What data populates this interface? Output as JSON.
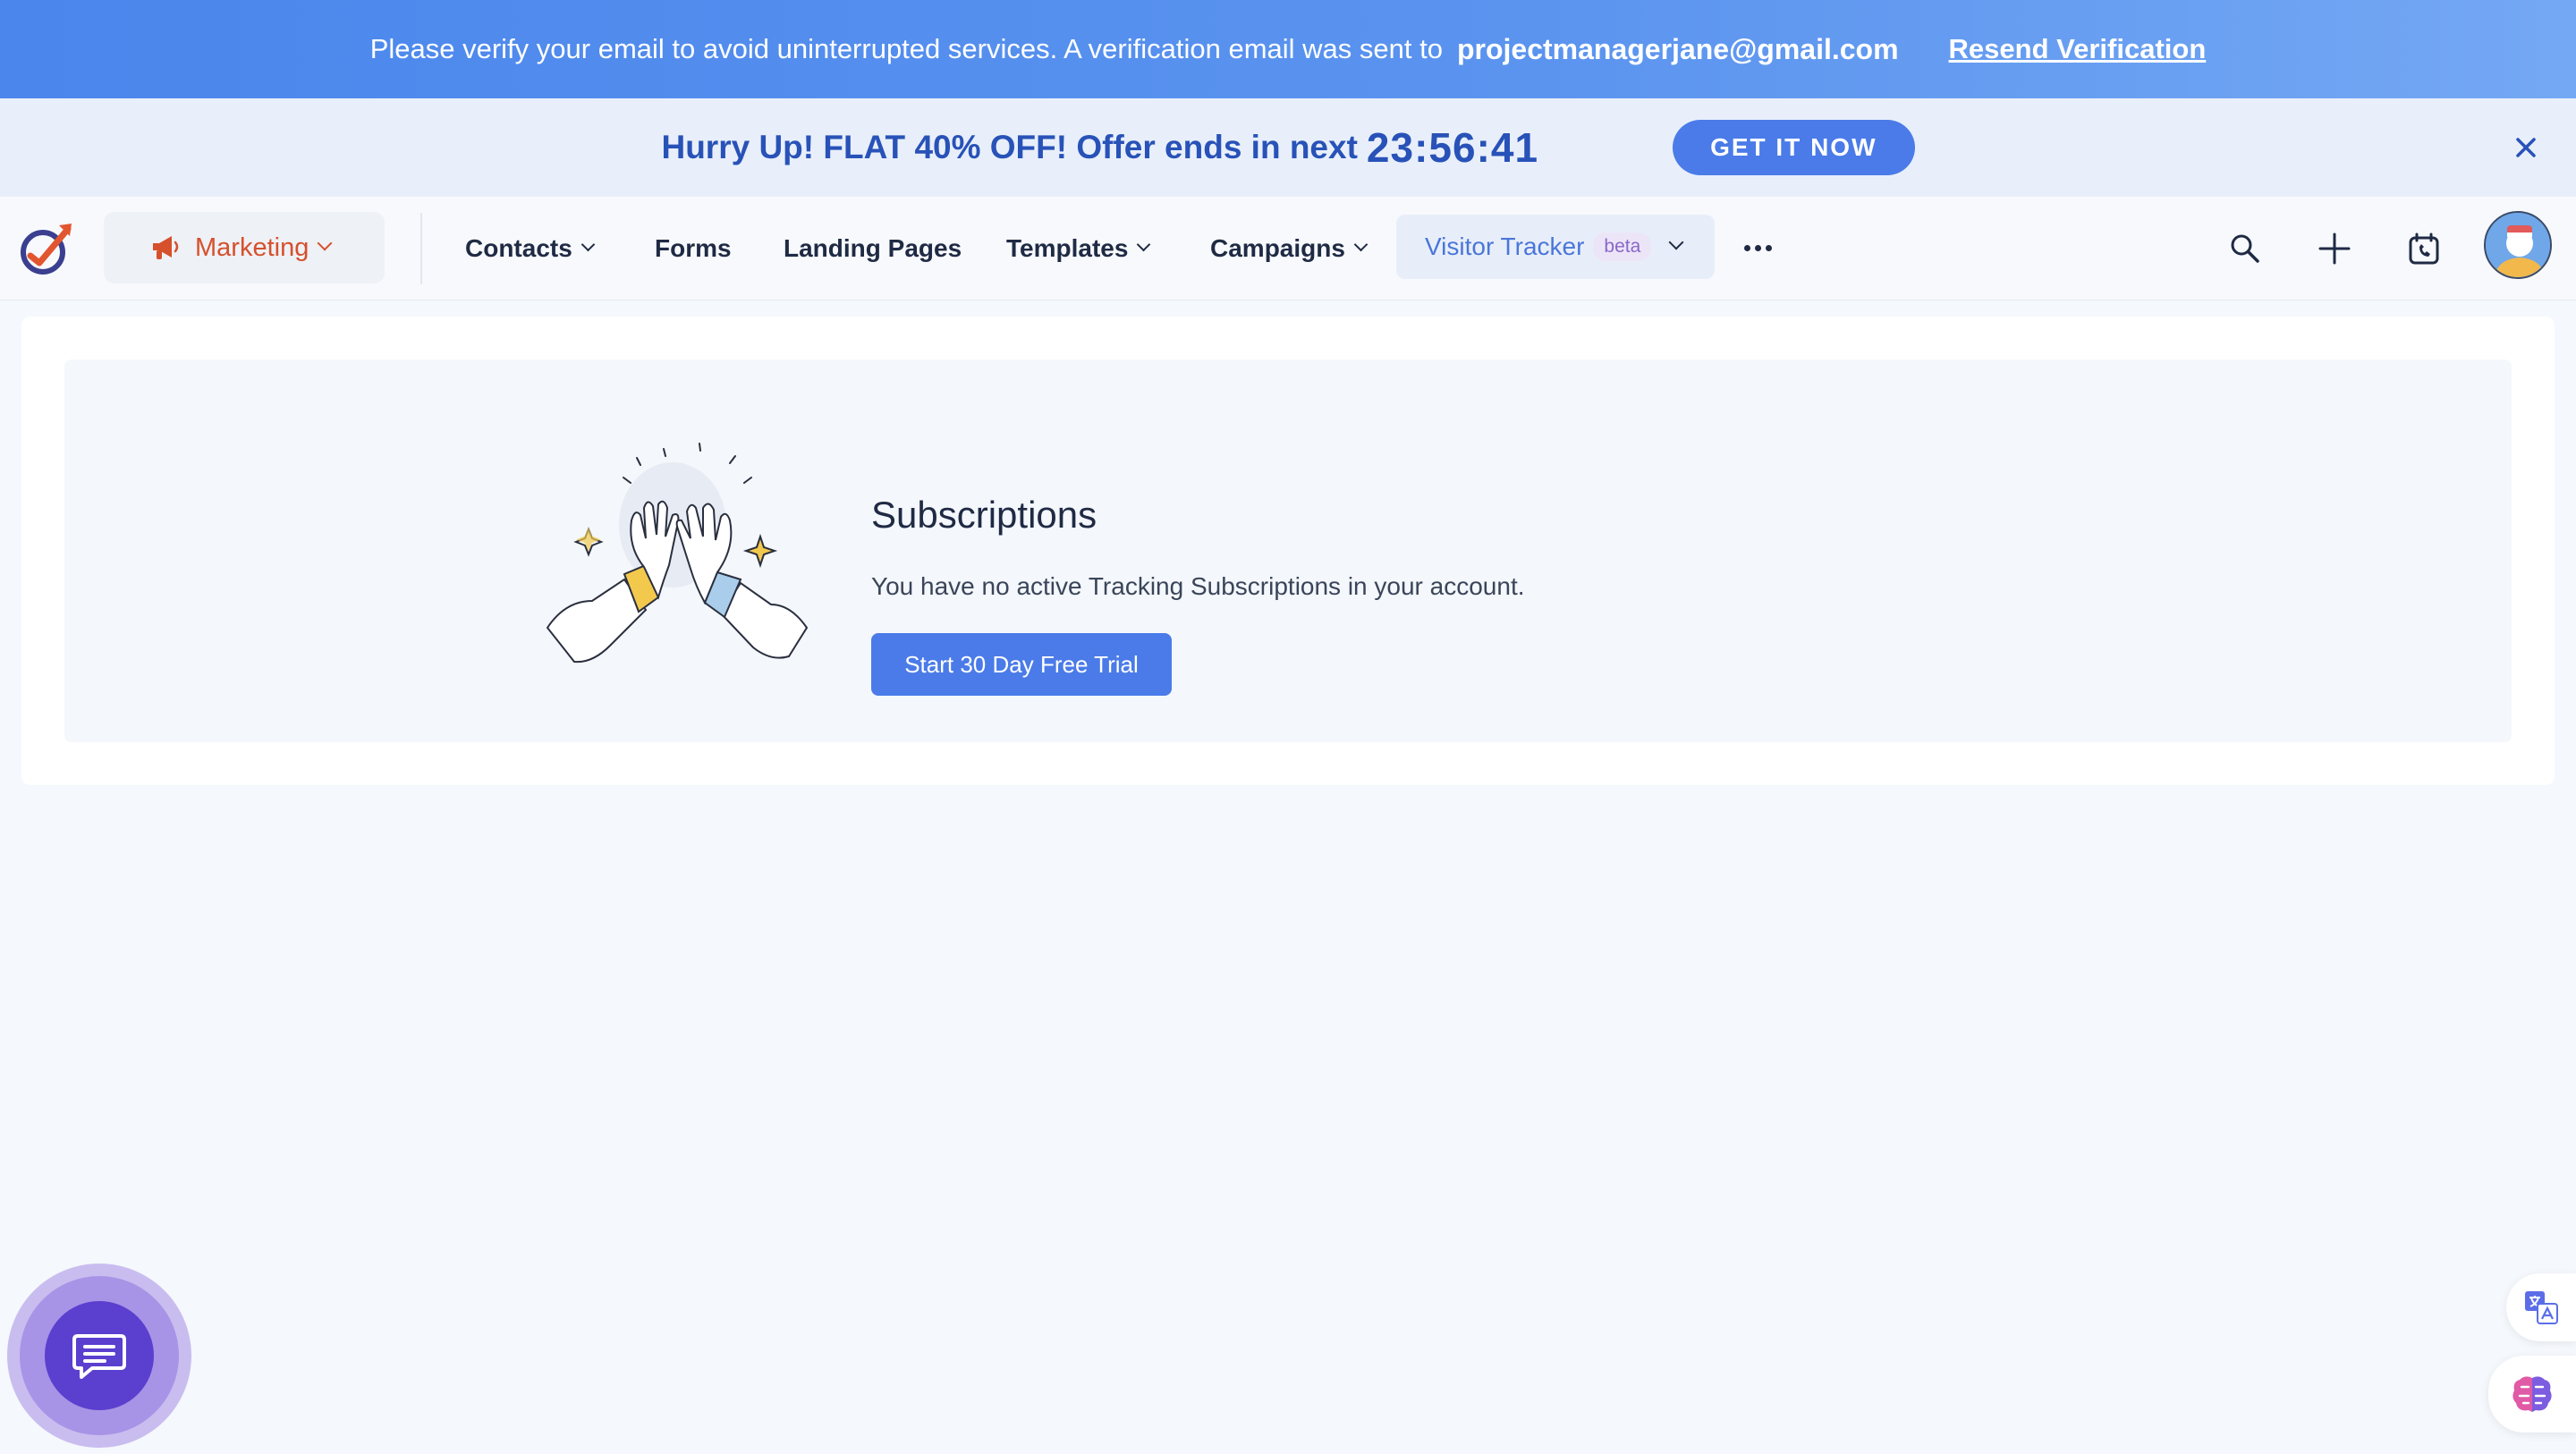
{
  "verify_banner": {
    "message": "Please verify your email to avoid uninterrupted services. A verification email was sent to",
    "email": "projectmanagerjane@gmail.com",
    "resend_label": "Resend Verification"
  },
  "promo_banner": {
    "text": "Hurry Up! FLAT 40% OFF! Offer ends in next",
    "timer": "23:56:41",
    "cta_label": "GET IT NOW",
    "close_icon": "close-icon"
  },
  "nav": {
    "module": {
      "label": "Marketing",
      "icon": "megaphone-icon"
    },
    "items": [
      {
        "label": "Contacts",
        "has_dropdown": true
      },
      {
        "label": "Forms",
        "has_dropdown": false
      },
      {
        "label": "Landing Pages",
        "has_dropdown": false
      },
      {
        "label": "Templates",
        "has_dropdown": true
      },
      {
        "label": "Campaigns",
        "has_dropdown": true
      }
    ],
    "visitor_tracker": {
      "label": "Visitor Tracker",
      "badge": "beta"
    },
    "right_icons": [
      "search-icon",
      "plus-icon",
      "calendar-phone-icon",
      "avatar"
    ]
  },
  "main": {
    "title": "Subscriptions",
    "description": "You have no active Tracking Subscriptions in your account.",
    "cta_label": "Start 30 Day Free Trial"
  },
  "colors": {
    "brand_blue": "#4a7be8",
    "promo_text": "#2852b8",
    "module_orange": "#d6502c",
    "chat_purple": "#5b3fcf"
  }
}
